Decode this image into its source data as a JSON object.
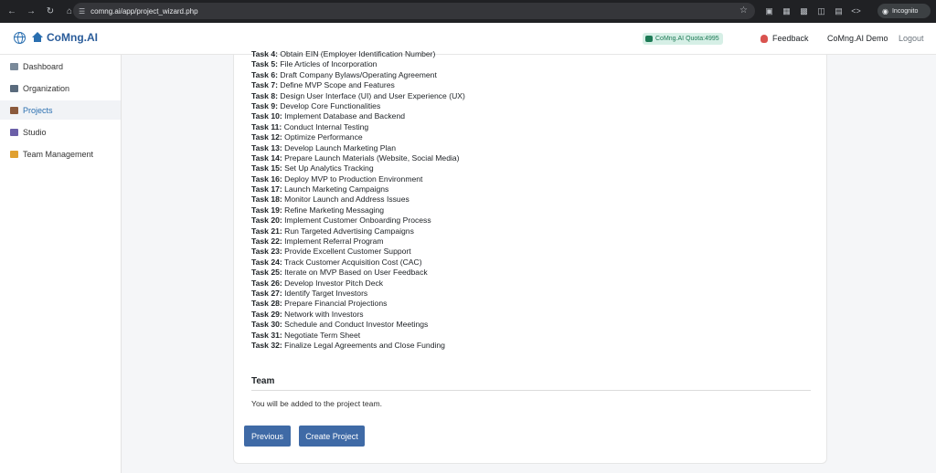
{
  "browser": {
    "url": "comng.ai/app/project_wizard.php",
    "mode_label": "Incognito"
  },
  "header": {
    "brand": "CoMng.AI",
    "quota": "CoMng.AI Quota:4995",
    "feedback": "Feedback",
    "user": "CoMng.AI Demo",
    "logout": "Logout"
  },
  "sidebar": {
    "items": [
      {
        "label": "Dashboard",
        "icon": "grid-icon",
        "active": false
      },
      {
        "label": "Organization",
        "icon": "building-icon",
        "active": false
      },
      {
        "label": "Projects",
        "icon": "briefcase-icon",
        "active": true
      },
      {
        "label": "Studio",
        "icon": "film-icon",
        "active": false
      },
      {
        "label": "Team Management",
        "icon": "people-icon",
        "active": false
      }
    ]
  },
  "tasks": [
    {
      "num": "Task 4:",
      "title": "Obtain EIN (Employer Identification Number)"
    },
    {
      "num": "Task 5:",
      "title": "File Articles of Incorporation"
    },
    {
      "num": "Task 6:",
      "title": "Draft Company Bylaws/Operating Agreement"
    },
    {
      "num": "Task 7:",
      "title": "Define MVP Scope and Features"
    },
    {
      "num": "Task 8:",
      "title": "Design User Interface (UI) and User Experience (UX)"
    },
    {
      "num": "Task 9:",
      "title": "Develop Core Functionalities"
    },
    {
      "num": "Task 10:",
      "title": "Implement Database and Backend"
    },
    {
      "num": "Task 11:",
      "title": "Conduct Internal Testing"
    },
    {
      "num": "Task 12:",
      "title": "Optimize Performance"
    },
    {
      "num": "Task 13:",
      "title": "Develop Launch Marketing Plan"
    },
    {
      "num": "Task 14:",
      "title": "Prepare Launch Materials (Website, Social Media)"
    },
    {
      "num": "Task 15:",
      "title": "Set Up Analytics Tracking"
    },
    {
      "num": "Task 16:",
      "title": "Deploy MVP to Production Environment"
    },
    {
      "num": "Task 17:",
      "title": "Launch Marketing Campaigns"
    },
    {
      "num": "Task 18:",
      "title": "Monitor Launch and Address Issues"
    },
    {
      "num": "Task 19:",
      "title": "Refine Marketing Messaging"
    },
    {
      "num": "Task 20:",
      "title": "Implement Customer Onboarding Process"
    },
    {
      "num": "Task 21:",
      "title": "Run Targeted Advertising Campaigns"
    },
    {
      "num": "Task 22:",
      "title": "Implement Referral Program"
    },
    {
      "num": "Task 23:",
      "title": "Provide Excellent Customer Support"
    },
    {
      "num": "Task 24:",
      "title": "Track Customer Acquisition Cost (CAC)"
    },
    {
      "num": "Task 25:",
      "title": "Iterate on MVP Based on User Feedback"
    },
    {
      "num": "Task 26:",
      "title": "Develop Investor Pitch Deck"
    },
    {
      "num": "Task 27:",
      "title": "Identify Target Investors"
    },
    {
      "num": "Task 28:",
      "title": "Prepare Financial Projections"
    },
    {
      "num": "Task 29:",
      "title": "Network with Investors"
    },
    {
      "num": "Task 30:",
      "title": "Schedule and Conduct Investor Meetings"
    },
    {
      "num": "Task 31:",
      "title": "Negotiate Term Sheet"
    },
    {
      "num": "Task 32:",
      "title": "Finalize Legal Agreements and Close Funding"
    }
  ],
  "team": {
    "title": "Team",
    "text": "You will be added to the project team."
  },
  "buttons": {
    "previous": "Previous",
    "create": "Create Project"
  },
  "colors": {
    "primary": "#3f6aa6",
    "brand": "#2a5c9a",
    "quota_bg": "#d6efe6",
    "quota_text": "#1d7a55"
  }
}
